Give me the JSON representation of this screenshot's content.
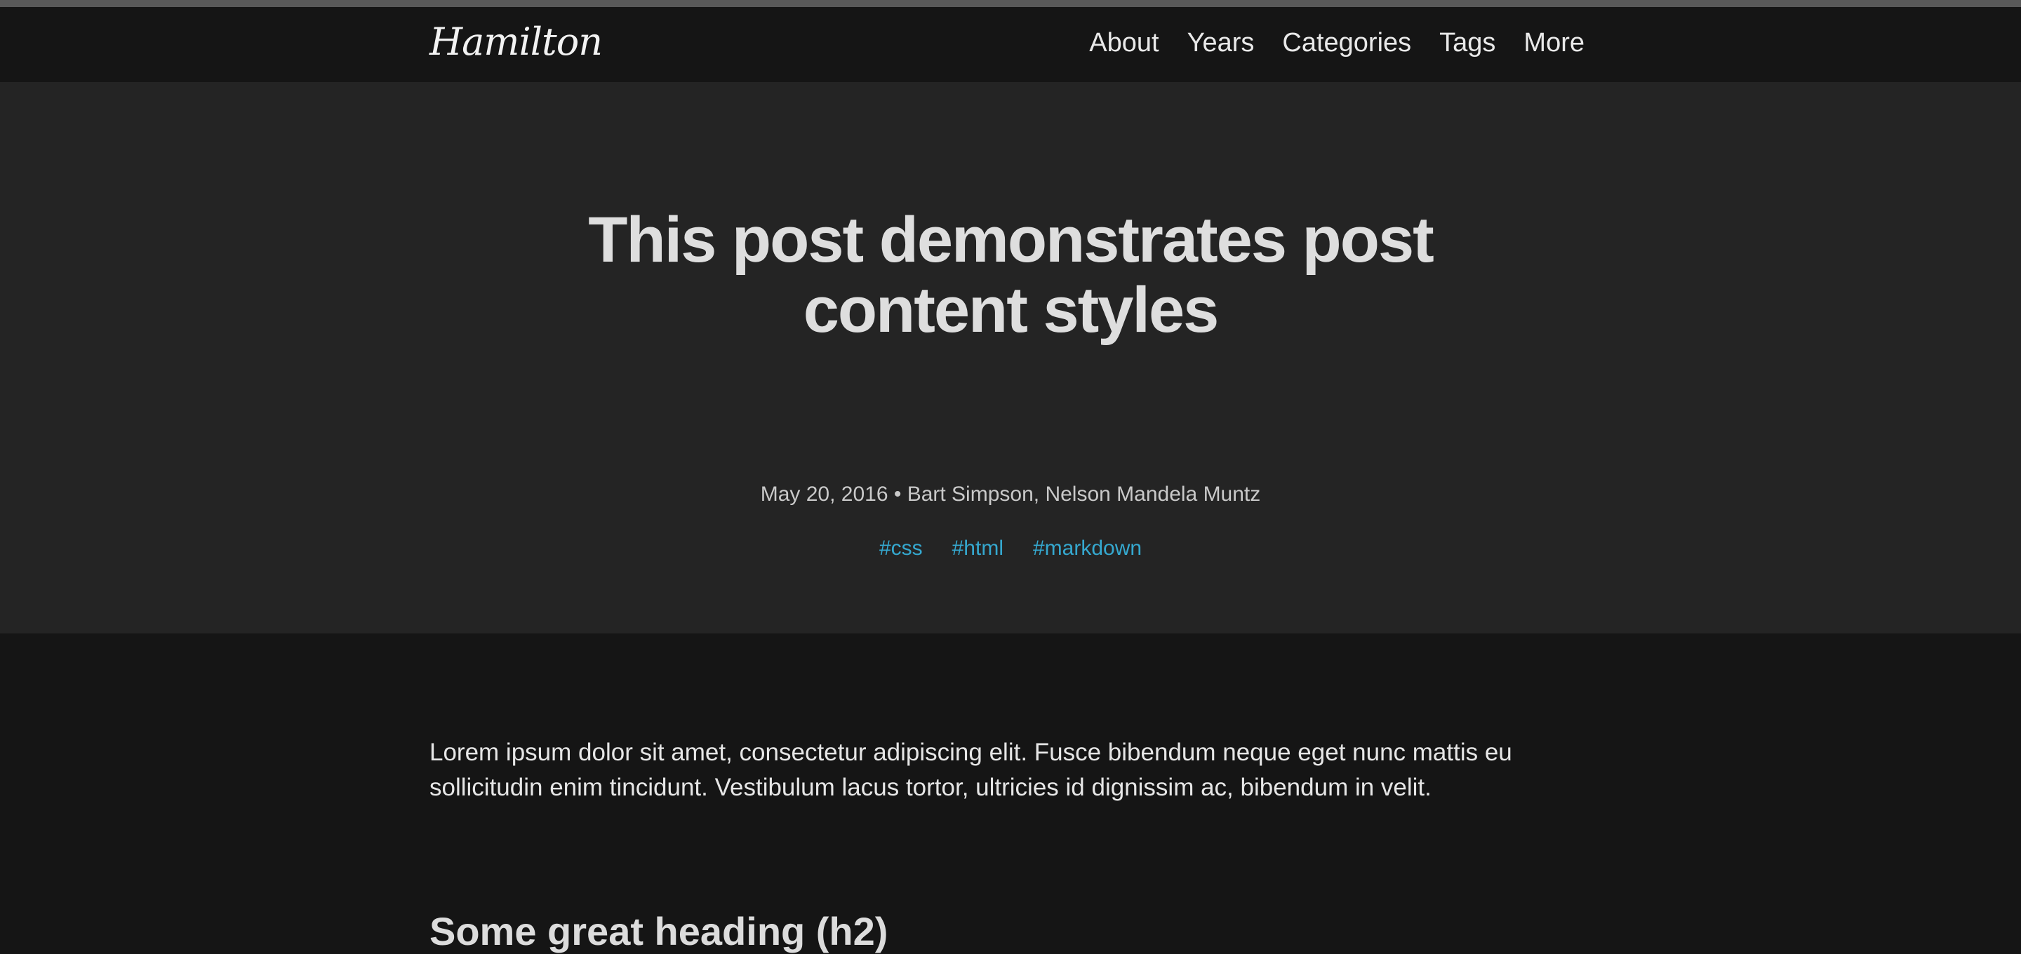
{
  "header": {
    "logo": "Hamilton",
    "nav": [
      "About",
      "Years",
      "Categories",
      "Tags",
      "More"
    ]
  },
  "post": {
    "title": "This post demonstrates post content styles",
    "meta": "May 20, 2016 • Bart Simpson, Nelson Mandela Muntz",
    "tags": [
      "#css",
      "#html",
      "#markdown"
    ],
    "paragraph": "Lorem ipsum dolor sit amet, consectetur adipiscing elit. Fusce bibendum neque eget nunc mattis eu sollicitudin enim tincidunt. Vestibulum lacus tortor, ultricies id dignissim ac, bibendum in velit.",
    "heading": "Some great heading (h2)"
  },
  "colors": {
    "header_bg": "#151515",
    "hero_bg": "#242424",
    "content_bg": "#151515",
    "tag_link": "#35a8cf",
    "top_strip": "#595959"
  }
}
